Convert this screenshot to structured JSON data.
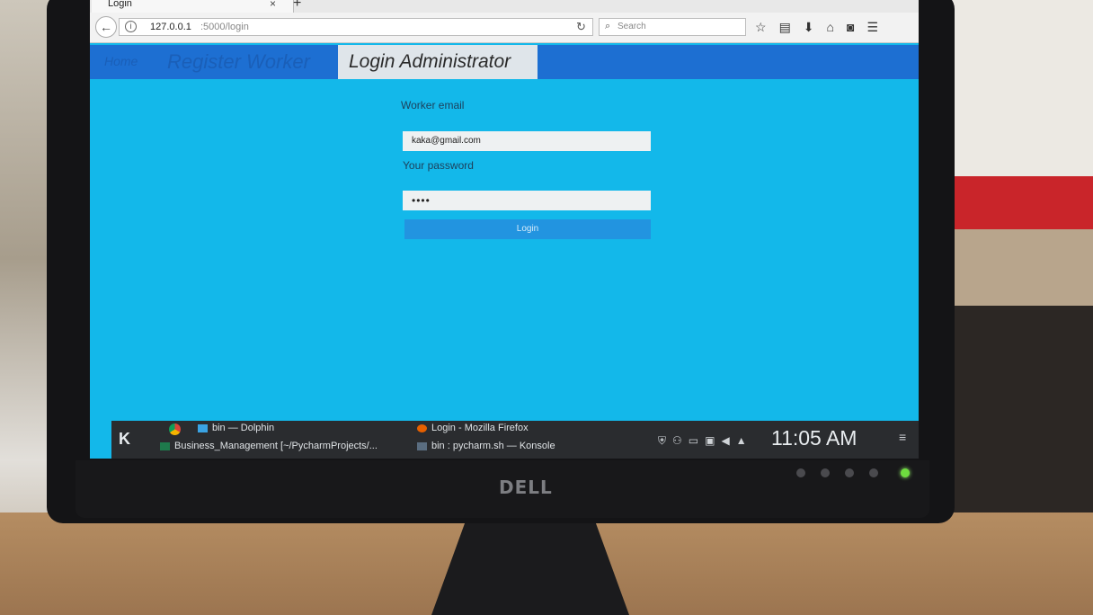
{
  "browser": {
    "tab_title": "Login",
    "tab_close": "×",
    "new_tab": "+",
    "url_host": "127.0.0.1",
    "url_path": ":5000/login",
    "search_placeholder": "Search"
  },
  "site_nav": {
    "home_label": "Home",
    "register_label": "Register Worker",
    "login_label": "Login Administrator"
  },
  "login_form": {
    "email_label": "Worker email",
    "email_value": "kaka@gmail.com",
    "password_label": "Your password",
    "password_value": "••••",
    "submit_label": "Login"
  },
  "taskbar": {
    "tasks": [
      {
        "label": "bin — Dolphin"
      },
      {
        "label": "Business_Management [~/PycharmProjects/..."
      },
      {
        "label": "Login - Mozilla Firefox"
      },
      {
        "label": "bin : pycharm.sh — Konsole"
      }
    ],
    "clock": "11:05 AM"
  },
  "hardware": {
    "brand": "DELL"
  },
  "colors": {
    "page_background": "#13b8ea",
    "nav_bar": "#1d6fd2",
    "login_button": "#2294e0",
    "taskbar": "#2a2c2f"
  }
}
